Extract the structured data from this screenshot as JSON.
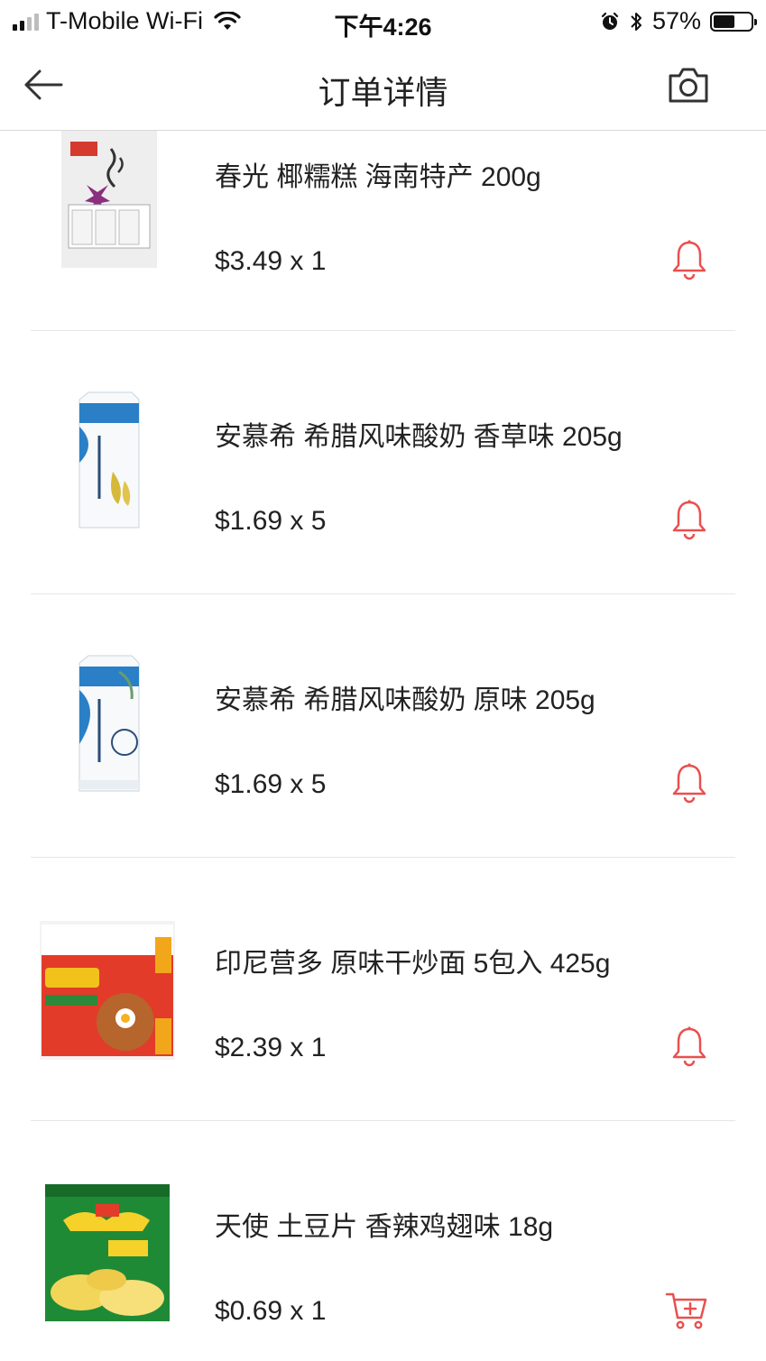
{
  "status_bar": {
    "carrier": "T-Mobile Wi-Fi",
    "time": "下午4:26",
    "battery_percent": "57%",
    "battery_level": 0.57,
    "signal_bars_active": 2,
    "signal_bars_total": 4,
    "icons": [
      "signal-icon",
      "wifi-icon",
      "alarm-icon",
      "bluetooth-icon",
      "battery-icon"
    ]
  },
  "nav": {
    "title": "订单详情",
    "back_icon": "back-arrow-icon",
    "camera_icon": "camera-icon"
  },
  "colors": {
    "accent": "#e8504f",
    "divider": "#e6e6e6",
    "text": "#222222"
  },
  "items": [
    {
      "name": "春光 椰糯糕 海南特产 200g",
      "price": "$3.49 x 1",
      "action_icon": "bell-icon"
    },
    {
      "name": "安慕希 希腊风味酸奶 香草味 205g",
      "price": "$1.69 x 5",
      "action_icon": "bell-icon"
    },
    {
      "name": "安慕希 希腊风味酸奶 原味 205g",
      "price": "$1.69 x 5",
      "action_icon": "bell-icon"
    },
    {
      "name": "印尼营多 原味干炒面 5包入 425g",
      "price": "$2.39 x 1",
      "action_icon": "bell-icon"
    },
    {
      "name": "天使 土豆片 香辣鸡翅味 18g",
      "price": "$0.69 x 1",
      "action_icon": "add-to-cart-icon"
    }
  ]
}
